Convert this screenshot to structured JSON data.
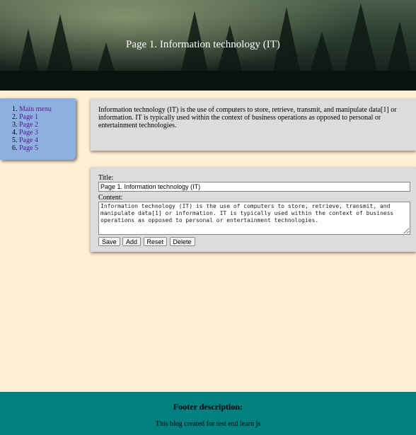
{
  "header": {
    "title": "Page 1. Information technology (IT)"
  },
  "sidebar": {
    "items": [
      {
        "label": "Main menu"
      },
      {
        "label": "Page 1"
      },
      {
        "label": "Page 2"
      },
      {
        "label": "Page 3"
      },
      {
        "label": "Page 4"
      },
      {
        "label": "Page 5"
      }
    ]
  },
  "info": {
    "text": "Information technology (IT) is the use of computers to store, retrieve, transmit, and manipulate data[1] or information. IT is typically used within the context of business operations as opposed to personal or entertainment technologies."
  },
  "editor": {
    "title_label": "Title:",
    "title_value": "Page 1. Information technology (IT)",
    "content_label": "Content:",
    "content_value": "Information technology (IT) is the use of computers to store, retrieve, transmit, and manipulate data[1] or information. IT is typically used within the context of business operations as opposed to personal or entertainment technologies.",
    "buttons": {
      "save": "Save",
      "add": "Add",
      "reset": "Reset",
      "delete": "Delete"
    }
  },
  "footer": {
    "heading": "Footer description:",
    "text": "This blog created for test end learn js"
  },
  "colors": {
    "background": "#ffefd4",
    "sidebar": "#8eb0e0",
    "panel": "#dcdcdc",
    "footer": "#008080",
    "link": "#551a8b"
  }
}
